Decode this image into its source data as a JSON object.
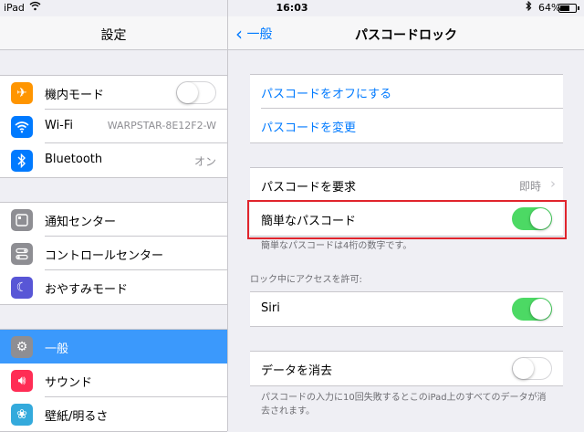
{
  "status": {
    "device": "iPad",
    "time": "16:03",
    "battery": "64%",
    "battery_fraction": 0.64
  },
  "sidebar": {
    "title": "設定",
    "groups": [
      [
        {
          "label": "機内モード",
          "icon": "airplane-icon",
          "color": "#ff9500",
          "toggle": "off"
        },
        {
          "label": "Wi-Fi",
          "value": "WARPSTAR-8E12F2-W",
          "icon": "wifi-icon",
          "color": "#007aff"
        },
        {
          "label": "Bluetooth",
          "value": "オン",
          "icon": "bluetooth-icon",
          "color": "#007aff"
        }
      ],
      [
        {
          "label": "通知センター",
          "icon": "notification-center-icon",
          "color": "#8e8e93"
        },
        {
          "label": "コントロールセンター",
          "icon": "control-center-icon",
          "color": "#8e8e93"
        },
        {
          "label": "おやすみモード",
          "icon": "moon-icon",
          "color": "#5856d6"
        }
      ],
      [
        {
          "label": "一般",
          "icon": "gear-icon",
          "color": "#8e8e93",
          "selected": true
        },
        {
          "label": "サウンド",
          "icon": "speaker-icon",
          "color": "#ff2d55"
        },
        {
          "label": "壁紙/明るさ",
          "icon": "flower-icon",
          "color": "#34aadc"
        }
      ]
    ]
  },
  "nav": {
    "back_label": "一般",
    "title": "パスコードロック"
  },
  "main": {
    "turn_off": "パスコードをオフにする",
    "change": "パスコードを変更",
    "require_label": "パスコードを要求",
    "require_value": "即時",
    "simple_label": "簡単なパスコード",
    "simple_note": "簡単なパスコードは4桁の数字です。",
    "allow_access_header": "ロック中にアクセスを許可:",
    "siri_label": "Siri",
    "erase_label": "データを消去",
    "erase_note": "パスコードの入力に10回失敗するとこのiPad上のすべてのデータが消去されます。"
  },
  "colors": {
    "accent": "#007aff",
    "toggle_on": "#4cd964",
    "selection": "#3b99fc",
    "highlight": "#e0242c"
  }
}
